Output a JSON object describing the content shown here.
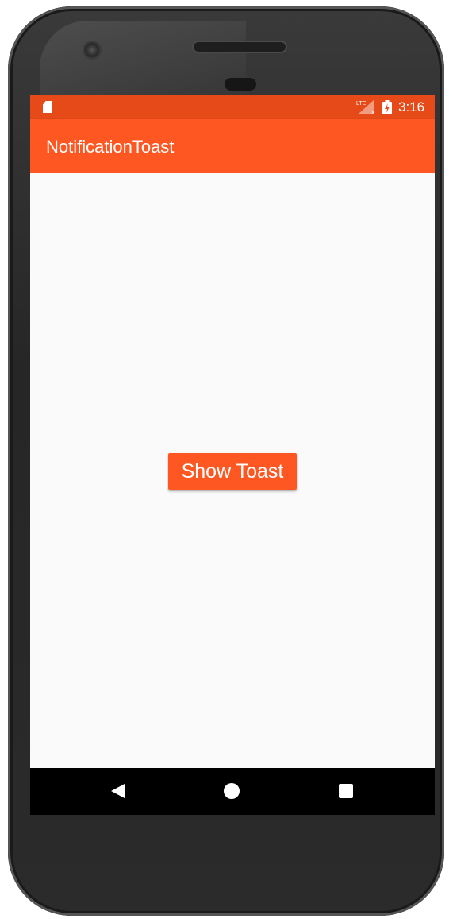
{
  "status_bar": {
    "time": "3:16",
    "network_label": "LTE",
    "icons": [
      "sd-card-icon",
      "lte-signal-icon",
      "battery-charging-icon"
    ]
  },
  "app_bar": {
    "title": "NotificationToast"
  },
  "main": {
    "show_toast_label": "Show Toast"
  },
  "nav_bar": {
    "icons": [
      "back-icon",
      "home-icon",
      "recents-icon"
    ]
  },
  "colors": {
    "primary": "#FF5722",
    "primary_dark": "#E64A19",
    "background": "#FAFAFA",
    "nav_bar": "#000000"
  }
}
